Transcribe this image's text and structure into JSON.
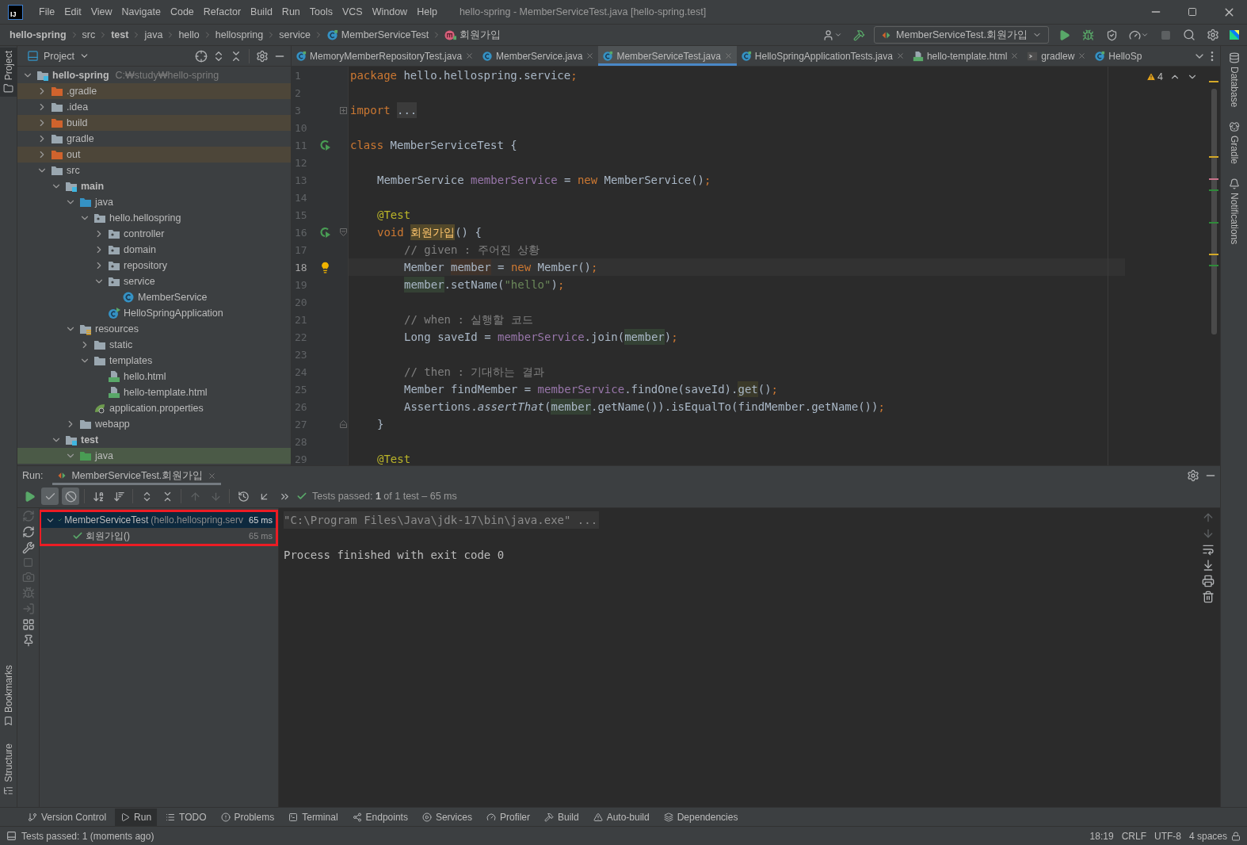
{
  "window": {
    "logo": "IJ",
    "title": "hello-spring - MemberServiceTest.java [hello-spring.test]"
  },
  "menu": [
    "File",
    "Edit",
    "View",
    "Navigate",
    "Code",
    "Refactor",
    "Build",
    "Run",
    "Tools",
    "VCS",
    "Window",
    "Help"
  ],
  "breadcrumbs": [
    {
      "label": "hello-spring",
      "bold": true
    },
    {
      "label": "src",
      "bold": false
    },
    {
      "label": "test",
      "bold": true
    },
    {
      "label": "java",
      "bold": false
    },
    {
      "label": "hello",
      "bold": false
    },
    {
      "label": "hellospring",
      "bold": false
    },
    {
      "label": "service",
      "bold": false
    },
    {
      "label": "MemberServiceTest",
      "bold": false
    },
    {
      "label": "회원가입",
      "bold": false
    }
  ],
  "run_configuration": "MemberServiceTest.회원가입",
  "left_stripe": [
    {
      "label": "Project",
      "selected": true
    },
    {
      "label": "Bookmarks",
      "selected": false
    },
    {
      "label": "Structure",
      "selected": false
    }
  ],
  "right_stripe": [
    "Database",
    "Gradle",
    "Notifications"
  ],
  "project": {
    "title": "Project",
    "tree": [
      {
        "label": "hello-spring",
        "path": "C:₩study₩hello-spring",
        "kind": "module",
        "bold": true,
        "expanded": true,
        "excluded": false,
        "selected": false,
        "children": [
          {
            "label": ".gradle",
            "kind": "excluded-folder",
            "bold": false,
            "expanded": false,
            "excluded": true,
            "selected": false
          },
          {
            "label": ".idea",
            "kind": "folder",
            "bold": false,
            "expanded": false,
            "excluded": false,
            "selected": false
          },
          {
            "label": "build",
            "kind": "excluded-folder",
            "bold": false,
            "expanded": false,
            "excluded": true,
            "selected": false
          },
          {
            "label": "gradle",
            "kind": "folder",
            "bold": false,
            "expanded": false,
            "excluded": false,
            "selected": false
          },
          {
            "label": "out",
            "kind": "excluded-folder",
            "bold": false,
            "expanded": false,
            "excluded": true,
            "selected": false
          },
          {
            "label": "src",
            "kind": "folder",
            "bold": false,
            "expanded": true,
            "excluded": false,
            "selected": false,
            "children": [
              {
                "label": "main",
                "kind": "module",
                "bold": true,
                "expanded": true,
                "excluded": false,
                "selected": false,
                "children": [
                  {
                    "label": "java",
                    "kind": "source-folder",
                    "bold": false,
                    "expanded": true,
                    "excluded": false,
                    "selected": false,
                    "children": [
                      {
                        "label": "hello.hellospring",
                        "kind": "package",
                        "bold": false,
                        "expanded": true,
                        "excluded": false,
                        "selected": false,
                        "children": [
                          {
                            "label": "controller",
                            "kind": "package",
                            "bold": false,
                            "expanded": false,
                            "excluded": false,
                            "selected": false
                          },
                          {
                            "label": "domain",
                            "kind": "package",
                            "bold": false,
                            "expanded": false,
                            "excluded": false,
                            "selected": false
                          },
                          {
                            "label": "repository",
                            "kind": "package",
                            "bold": false,
                            "expanded": false,
                            "excluded": false,
                            "selected": false
                          },
                          {
                            "label": "service",
                            "kind": "package",
                            "bold": false,
                            "expanded": true,
                            "excluded": false,
                            "selected": false,
                            "children": [
                              {
                                "label": "MemberService",
                                "kind": "class",
                                "bold": false,
                                "excluded": false,
                                "selected": false
                              }
                            ]
                          },
                          {
                            "label": "HelloSpringApplication",
                            "kind": "app",
                            "bold": false,
                            "excluded": false,
                            "selected": false
                          }
                        ]
                      }
                    ]
                  },
                  {
                    "label": "resources",
                    "kind": "resources",
                    "bold": false,
                    "expanded": true,
                    "excluded": false,
                    "selected": false,
                    "children": [
                      {
                        "label": "static",
                        "kind": "folder",
                        "bold": false,
                        "expanded": false,
                        "excluded": false,
                        "selected": false
                      },
                      {
                        "label": "templates",
                        "kind": "folder",
                        "bold": false,
                        "expanded": true,
                        "excluded": false,
                        "selected": false,
                        "children": [
                          {
                            "label": "hello.html",
                            "kind": "html",
                            "bold": false,
                            "excluded": false,
                            "selected": false
                          },
                          {
                            "label": "hello-template.html",
                            "kind": "html",
                            "bold": false,
                            "excluded": false,
                            "selected": false
                          }
                        ]
                      },
                      {
                        "label": "application.properties",
                        "kind": "properties",
                        "bold": false,
                        "excluded": false,
                        "selected": false
                      }
                    ]
                  },
                  {
                    "label": "webapp",
                    "kind": "folder",
                    "bold": false,
                    "expanded": false,
                    "excluded": false,
                    "selected": false
                  }
                ]
              },
              {
                "label": "test",
                "kind": "module",
                "bold": true,
                "expanded": true,
                "excluded": false,
                "selected": false,
                "children": [
                  {
                    "label": "java",
                    "kind": "test-folder",
                    "bold": false,
                    "expanded": true,
                    "excluded": false,
                    "selected": true
                  }
                ]
              }
            ]
          }
        ]
      }
    ]
  },
  "editor": {
    "tabs": [
      {
        "label": "MemoryMemberRepositoryTest.java",
        "kind": "test-class",
        "selected": false,
        "closable": true
      },
      {
        "label": "MemberService.java",
        "kind": "class",
        "selected": false,
        "closable": true
      },
      {
        "label": "MemberServiceTest.java",
        "kind": "test-class",
        "selected": true,
        "closable": true
      },
      {
        "label": "HelloSpringApplicationTests.java",
        "kind": "test-class",
        "selected": false,
        "closable": true
      },
      {
        "label": "hello-template.html",
        "kind": "html",
        "selected": false,
        "closable": true
      },
      {
        "label": "gradlew",
        "kind": "script",
        "selected": false,
        "closable": true
      },
      {
        "label": "HelloSp",
        "kind": "test-class",
        "selected": false,
        "closable": false
      }
    ],
    "warnings": "4",
    "lines": [
      {
        "number": "1",
        "kind": "top",
        "current": false,
        "tokens": [
          {
            "t": "package",
            "kind": "kw"
          },
          {
            "t": " hello.hellospring.service",
            "kind": "plain"
          },
          {
            "t": ";",
            "kind": "kw"
          }
        ]
      },
      {
        "number": "2",
        "current": false
      },
      {
        "number": "3",
        "kind": "top",
        "current": false,
        "folded": true,
        "tokens": [
          {
            "t": "import ",
            "kind": "kw"
          },
          {
            "t": "...",
            "kind": "folded"
          }
        ]
      },
      {
        "number": "10",
        "current": false
      },
      {
        "number": "11",
        "kind": "top",
        "current": false,
        "runnable": true,
        "tokens": [
          {
            "t": "class",
            "kind": "kw"
          },
          {
            "t": " MemberServiceTest {",
            "kind": "plain"
          }
        ]
      },
      {
        "number": "12",
        "current": false
      },
      {
        "number": "13",
        "kind": "member",
        "current": false,
        "tokens": [
          {
            "t": "MemberService ",
            "kind": "plain"
          },
          {
            "t": "memberService",
            "kind": "field"
          },
          {
            "t": " = ",
            "kind": "plain"
          },
          {
            "t": "new",
            "kind": "kw"
          },
          {
            "t": " MemberService()",
            "kind": "plain"
          },
          {
            "t": ";",
            "kind": "kw"
          }
        ]
      },
      {
        "number": "14",
        "current": false
      },
      {
        "number": "15",
        "kind": "member",
        "current": false,
        "tokens": [
          {
            "t": "@Test",
            "kind": "ann"
          }
        ]
      },
      {
        "number": "16",
        "kind": "member",
        "current": false,
        "runnable": true,
        "block_start": true,
        "tokens": [
          {
            "t": "void ",
            "kind": "kw"
          },
          {
            "t": "회원가입",
            "kind": "method-decl"
          },
          {
            "t": "() {",
            "kind": "plain"
          }
        ]
      },
      {
        "number": "17",
        "kind": "statement",
        "current": false,
        "tokens": [
          {
            "t": "// given : 주어진 상황",
            "kind": "comment"
          }
        ]
      },
      {
        "number": "18",
        "kind": "statement",
        "current": true,
        "intention": true,
        "tokens": [
          {
            "t": "Member ",
            "kind": "plain"
          },
          {
            "t": "member",
            "kind": "decl"
          },
          {
            "t": " = ",
            "kind": "plain"
          },
          {
            "t": "new",
            "kind": "kw"
          },
          {
            "t": " Member()",
            "kind": "plain"
          },
          {
            "t": ";",
            "kind": "kw"
          }
        ]
      },
      {
        "number": "19",
        "kind": "statement",
        "current": false,
        "tokens": [
          {
            "t": "member",
            "kind": "usage"
          },
          {
            "t": ".setName(",
            "kind": "plain"
          },
          {
            "t": "\"hello\"",
            "kind": "str"
          },
          {
            "t": ")",
            "kind": "plain"
          },
          {
            "t": ";",
            "kind": "kw"
          }
        ]
      },
      {
        "number": "20",
        "current": false
      },
      {
        "number": "21",
        "kind": "statement",
        "current": false,
        "tokens": [
          {
            "t": "// when : 실행할 코드",
            "kind": "comment"
          }
        ]
      },
      {
        "number": "22",
        "kind": "statement",
        "current": false,
        "tokens": [
          {
            "t": "Long saveId = ",
            "kind": "plain"
          },
          {
            "t": "memberService",
            "kind": "field"
          },
          {
            "t": ".join(",
            "kind": "plain"
          },
          {
            "t": "member",
            "kind": "usage"
          },
          {
            "t": ")",
            "kind": "plain"
          },
          {
            "t": ";",
            "kind": "kw"
          }
        ]
      },
      {
        "number": "23",
        "current": false
      },
      {
        "number": "24",
        "kind": "statement",
        "current": false,
        "tokens": [
          {
            "t": "// then : 기대하는 결과",
            "kind": "comment"
          }
        ]
      },
      {
        "number": "25",
        "kind": "statement",
        "current": false,
        "tokens": [
          {
            "t": "Member findMember = ",
            "kind": "plain"
          },
          {
            "t": "memberService",
            "kind": "field"
          },
          {
            "t": ".findOne(saveId).",
            "kind": "plain"
          },
          {
            "t": "get",
            "kind": "call-hl"
          },
          {
            "t": "()",
            "kind": "plain"
          },
          {
            "t": ";",
            "kind": "kw"
          }
        ]
      },
      {
        "number": "26",
        "kind": "statement",
        "current": false,
        "tokens": [
          {
            "t": "Assertions.",
            "kind": "plain"
          },
          {
            "t": "assertThat",
            "kind": "ital"
          },
          {
            "t": "(",
            "kind": "plain"
          },
          {
            "t": "member",
            "kind": "usage"
          },
          {
            "t": ".getName()).isEqualTo(findMember.getName())",
            "kind": "plain"
          },
          {
            "t": ";",
            "kind": "kw"
          }
        ]
      },
      {
        "number": "27",
        "kind": "member",
        "current": false,
        "block_end": true,
        "tokens": [
          {
            "t": "}",
            "kind": "plain"
          }
        ]
      },
      {
        "number": "28",
        "current": false
      },
      {
        "number": "29",
        "kind": "member",
        "current": false,
        "tokens": [
          {
            "t": "@Test",
            "kind": "ann"
          }
        ]
      }
    ]
  },
  "run": {
    "label": "Run:",
    "tab": "MemberServiceTest.회원가입",
    "toolbar": [
      {
        "kind": "rerun",
        "selected": false,
        "disabled": false
      },
      {
        "kind": "show-passed",
        "selected": true,
        "disabled": false
      },
      {
        "kind": "show-ignored",
        "selected": true,
        "disabled": false
      },
      {
        "kind": "sort-alpha",
        "selected": false,
        "disabled": false
      },
      {
        "kind": "sort-duration",
        "selected": false,
        "disabled": false
      },
      {
        "kind": "expand-all",
        "selected": false,
        "disabled": false
      },
      {
        "kind": "collapse-all",
        "selected": false,
        "disabled": false
      },
      {
        "kind": "previous",
        "selected": false,
        "disabled": true
      },
      {
        "kind": "next",
        "selected": false,
        "disabled": true
      },
      {
        "kind": "history",
        "selected": false,
        "disabled": false
      },
      {
        "kind": "import",
        "selected": false,
        "disabled": false
      },
      {
        "kind": "more",
        "selected": false,
        "disabled": false
      }
    ],
    "status": "Tests passed: **1** of 1 test – 65 ms",
    "test_tree": {
      "outlined": true,
      "rows": [
        {
          "name": "MemberServiceTest",
          "detail": "(hello.hellospring.serv",
          "time": "65 ms",
          "passed": true,
          "expanded": true,
          "selected": true,
          "children": [
            {
              "name": "회원가입()",
              "time": "65 ms",
              "passed": true,
              "selected": false
            }
          ]
        }
      ]
    },
    "console": [
      {
        "text": "\"C:\\Program Files\\Java\\jdk-17\\bin\\java.exe\" ...",
        "kind": "command"
      },
      {
        "text": "Process finished with exit code 0",
        "kind": "exit"
      }
    ]
  },
  "tool_windows": [
    {
      "label": "Version Control",
      "kind": "branch",
      "selected": false
    },
    {
      "label": "Run",
      "kind": "play",
      "selected": true
    },
    {
      "label": "TODO",
      "kind": "list",
      "selected": false
    },
    {
      "label": "Problems",
      "kind": "alert",
      "selected": false
    },
    {
      "label": "Terminal",
      "kind": "terminal",
      "selected": false
    },
    {
      "label": "Endpoints",
      "kind": "share",
      "selected": false
    },
    {
      "label": "Services",
      "kind": "services",
      "selected": false
    },
    {
      "label": "Profiler",
      "kind": "gauge",
      "selected": false
    },
    {
      "label": "Build",
      "kind": "hammer",
      "selected": false
    },
    {
      "label": "Auto-build",
      "kind": "warning",
      "selected": false
    },
    {
      "label": "Dependencies",
      "kind": "layers",
      "selected": false
    }
  ],
  "status_bar": {
    "message": "Tests passed: 1 (moments ago)",
    "items": [
      "18:19",
      "CRLF",
      "UTF-8",
      "4 spaces"
    ]
  }
}
